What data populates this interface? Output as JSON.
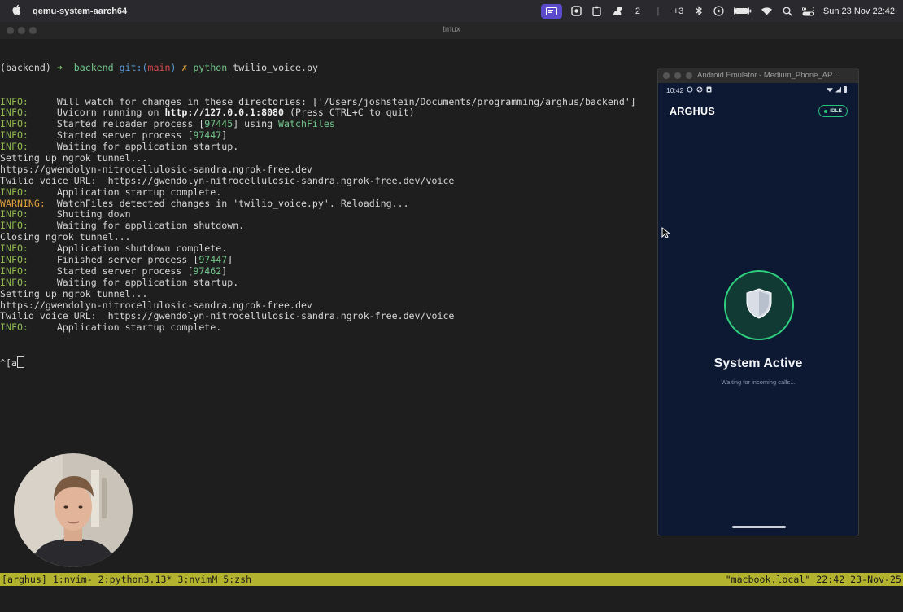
{
  "menubar": {
    "app_name": "qemu-system-aarch64",
    "badge_count": "2",
    "extra_count": "+3",
    "clock": "Sun 23 Nov  22:42",
    "icons": [
      "apple-logo",
      "screen-capture",
      "screenshot",
      "clipboard",
      "squirrel",
      "bluetooth",
      "play-circle",
      "battery",
      "wifi",
      "search",
      "control-center"
    ]
  },
  "window": {
    "title": "tmux"
  },
  "terminal": {
    "prompt_env": "(backend)",
    "prompt_arrow": "➜",
    "prompt_dir": "backend",
    "prompt_git": "git:(",
    "prompt_branch": "main",
    "prompt_git_close": ")",
    "prompt_x": "✗",
    "command": "python",
    "command_arg": "twilio_voice.py",
    "lines": [
      {
        "tag": "INFO:",
        "pad": "     ",
        "text": "Will watch for changes in these directories: ['/Users/joshstein/Documents/programming/arghus/backend']"
      },
      {
        "tag": "INFO:",
        "pad": "     ",
        "pre": "Uvicorn running on ",
        "bold": "http://127.0.0.1:8080",
        "post": " (Press CTRL+C to quit)"
      },
      {
        "tag": "INFO:",
        "pad": "     ",
        "pre": "Started reloader process [",
        "num": "97445",
        "post": "] using ",
        "green": "WatchFiles"
      },
      {
        "tag": "INFO:",
        "pad": "     ",
        "pre": "Started server process [",
        "num": "97447",
        "post": "]"
      },
      {
        "tag": "INFO:",
        "pad": "     ",
        "text": "Waiting for application startup."
      },
      {
        "plain": "Setting up ngrok tunnel..."
      },
      {
        "plain": "https://gwendolyn-nitrocellulosic-sandra.ngrok-free.dev"
      },
      {
        "plain": "Twilio voice URL:  https://gwendolyn-nitrocellulosic-sandra.ngrok-free.dev/voice"
      },
      {
        "tag": "INFO:",
        "pad": "     ",
        "text": "Application startup complete."
      },
      {
        "warn": "WARNING:",
        "pad": "  ",
        "text": "WatchFiles detected changes in 'twilio_voice.py'. Reloading..."
      },
      {
        "tag": "INFO:",
        "pad": "     ",
        "text": "Shutting down"
      },
      {
        "tag": "INFO:",
        "pad": "     ",
        "text": "Waiting for application shutdown."
      },
      {
        "plain": "Closing ngrok tunnel..."
      },
      {
        "tag": "INFO:",
        "pad": "     ",
        "text": "Application shutdown complete."
      },
      {
        "tag": "INFO:",
        "pad": "     ",
        "pre": "Finished server process [",
        "num": "97447",
        "post": "]"
      },
      {
        "tag": "INFO:",
        "pad": "     ",
        "pre": "Started server process [",
        "num": "97462",
        "post": "]"
      },
      {
        "tag": "INFO:",
        "pad": "     ",
        "text": "Waiting for application startup."
      },
      {
        "plain": "Setting up ngrok tunnel..."
      },
      {
        "plain": "https://gwendolyn-nitrocellulosic-sandra.ngrok-free.dev"
      },
      {
        "plain": "Twilio voice URL:  https://gwendolyn-nitrocellulosic-sandra.ngrok-free.dev/voice"
      },
      {
        "tag": "INFO:",
        "pad": "     ",
        "text": "Application startup complete."
      }
    ],
    "last_input": "^[a"
  },
  "emulator": {
    "window_title": "Android Emulator - Medium_Phone_AP...",
    "status_time": "10:42",
    "app_title": "ARGHUS",
    "status_badge": "IDLE",
    "main_title": "System Active",
    "subtitle": "Waiting for incoming calls...",
    "accent_color": "#2fcf7f"
  },
  "tmux": {
    "left": "[arghus] 1:nvim- 2:python3.13* 3:nvimM 5:zsh",
    "right": "\"macbook.local\" 22:42 23-Nov-25"
  }
}
